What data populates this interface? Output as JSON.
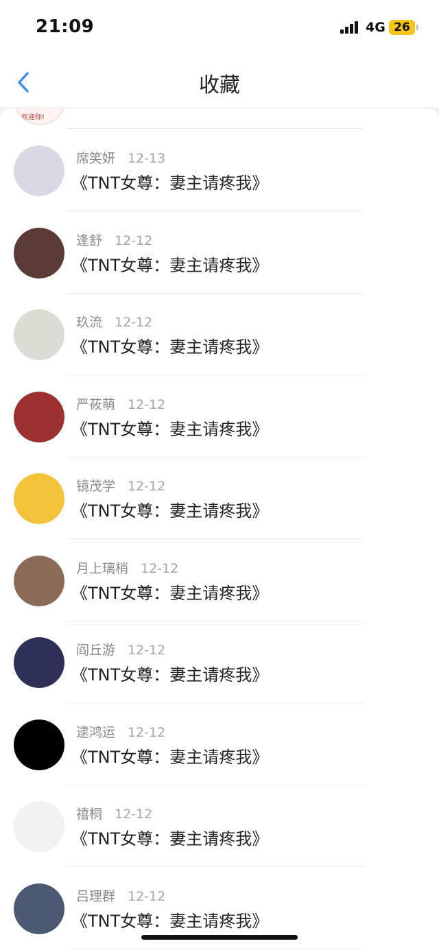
{
  "status_bar": {
    "time": "21:09",
    "network": "4G",
    "battery": "26",
    "battery_color": "#f5c518"
  },
  "nav": {
    "title": "收藏",
    "back_icon": "chevron-left-icon",
    "accent": "#3d8ef7"
  },
  "partial_item_avatar_text": "欢迎你!",
  "items": [
    {
      "user": "席笑妍",
      "date": "12-13",
      "book": "《TNT女尊：妻主请疼我》",
      "avatar_color": "#d9d9e6"
    },
    {
      "user": "逢舒",
      "date": "12-12",
      "book": "《TNT女尊：妻主请疼我》",
      "avatar_color": "#5a3b35"
    },
    {
      "user": "玖流",
      "date": "12-12",
      "book": "《TNT女尊：妻主请疼我》",
      "avatar_color": "#d9ddd4"
    },
    {
      "user": "严莜萌",
      "date": "12-12",
      "book": "《TNT女尊：妻主请疼我》",
      "avatar_color": "#9c2f2f"
    },
    {
      "user": "镜茂学",
      "date": "12-12",
      "book": "《TNT女尊：妻主请疼我》",
      "avatar_color": "#f3c33a"
    },
    {
      "user": "月上璃梢",
      "date": "12-12",
      "book": "《TNT女尊：妻主请疼我》",
      "avatar_color": "#8a6b57"
    },
    {
      "user": "阎丘游",
      "date": "12-12",
      "book": "《TNT女尊：妻主请疼我》",
      "avatar_color": "#2f3057"
    },
    {
      "user": "逮鸿运",
      "date": "12-12",
      "book": "《TNT女尊：妻主请疼我》",
      "avatar_color": "#000000"
    },
    {
      "user": "禧桐",
      "date": "12-12",
      "book": "《TNT女尊：妻主请疼我》",
      "avatar_color": "#f2f2f2"
    },
    {
      "user": "吕理群",
      "date": "12-12",
      "book": "《TNT女尊：妻主请疼我》",
      "avatar_color": "#4b5a72"
    }
  ]
}
